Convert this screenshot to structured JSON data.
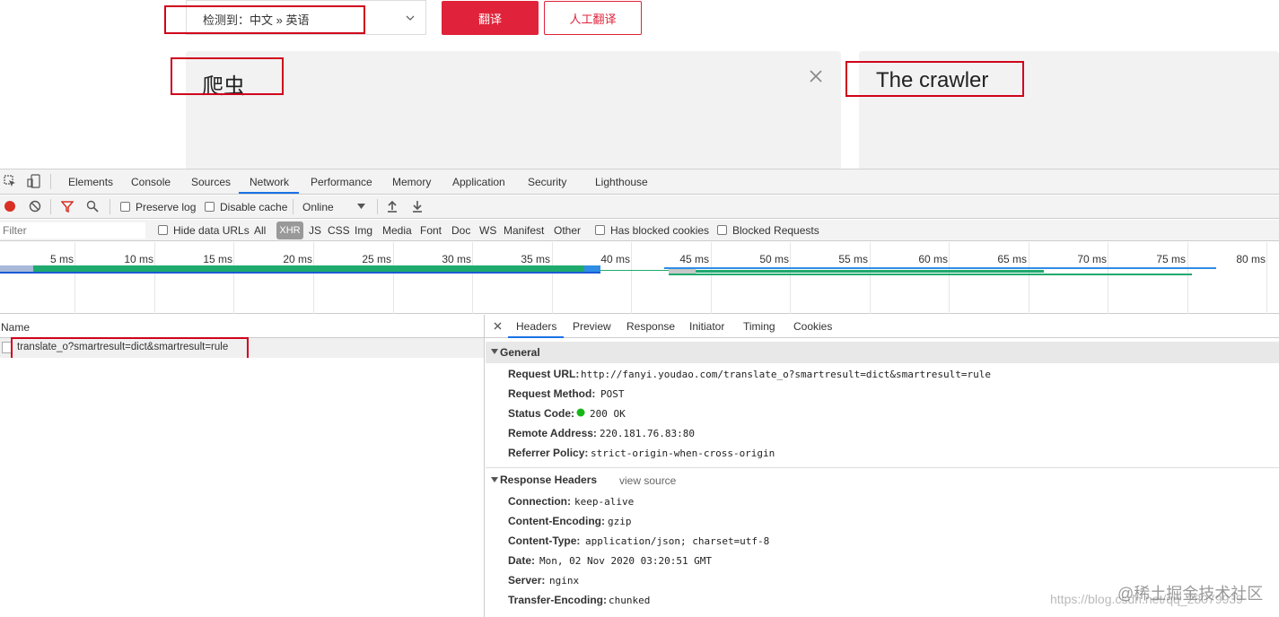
{
  "translator": {
    "lang_select": "检测到：中文 » 英语",
    "translate_button": "翻译",
    "human_button": "人工翻译",
    "source_text": "爬虫",
    "result_text": "The crawler"
  },
  "devtools": {
    "tabs": [
      "Elements",
      "Console",
      "Sources",
      "Network",
      "Performance",
      "Memory",
      "Application",
      "Security",
      "Lighthouse"
    ],
    "toolbar": {
      "preserve_log": "Preserve log",
      "disable_cache": "Disable cache",
      "throttle": "Online"
    },
    "filter": {
      "placeholder": "Filter",
      "hide_data_urls": "Hide data URLs",
      "types": [
        "All",
        "XHR",
        "JS",
        "CSS",
        "Img",
        "Media",
        "Font",
        "Doc",
        "WS",
        "Manifest",
        "Other"
      ],
      "has_blocked_cookies": "Has blocked cookies",
      "blocked_requests": "Blocked Requests"
    },
    "timeline_ticks": [
      "5 ms",
      "10 ms",
      "15 ms",
      "20 ms",
      "25 ms",
      "30 ms",
      "35 ms",
      "40 ms",
      "45 ms",
      "50 ms",
      "55 ms",
      "60 ms",
      "65 ms",
      "70 ms",
      "75 ms",
      "80 ms"
    ],
    "list": {
      "header": "Name",
      "request": "translate_o?smartresult=dict&smartresult=rule"
    },
    "detail_tabs": [
      "Headers",
      "Preview",
      "Response",
      "Initiator",
      "Timing",
      "Cookies"
    ],
    "general": {
      "title": "General",
      "rows": [
        {
          "key": "Request URL:",
          "value": "http://fanyi.youdao.com/translate_o?smartresult=dict&smartresult=rule"
        },
        {
          "key": "Request Method:",
          "value": "POST"
        },
        {
          "key": "Status Code:",
          "value": "200 OK"
        },
        {
          "key": "Remote Address:",
          "value": "220.181.76.83:80"
        },
        {
          "key": "Referrer Policy:",
          "value": "strict-origin-when-cross-origin"
        }
      ]
    },
    "response_headers": {
      "title": "Response Headers",
      "view_source": "view source",
      "rows": [
        {
          "key": "Connection:",
          "value": "keep-alive"
        },
        {
          "key": "Content-Encoding:",
          "value": "gzip"
        },
        {
          "key": "Content-Type:",
          "value": "application/json; charset=utf-8"
        },
        {
          "key": "Date:",
          "value": "Mon, 02 Nov 2020 03:20:51 GMT"
        },
        {
          "key": "Server:",
          "value": "nginx"
        },
        {
          "key": "Transfer-Encoding:",
          "value": "chunked"
        }
      ]
    }
  },
  "watermark": {
    "url": "https://blog.csdn.net/qq_28079939",
    "site": "@稀土掘金技术社区"
  },
  "colors": {
    "accent": "#e0233a",
    "highlight": "#d0021b",
    "tab_active": "#1a73e8",
    "status_ok": "#17b617"
  }
}
